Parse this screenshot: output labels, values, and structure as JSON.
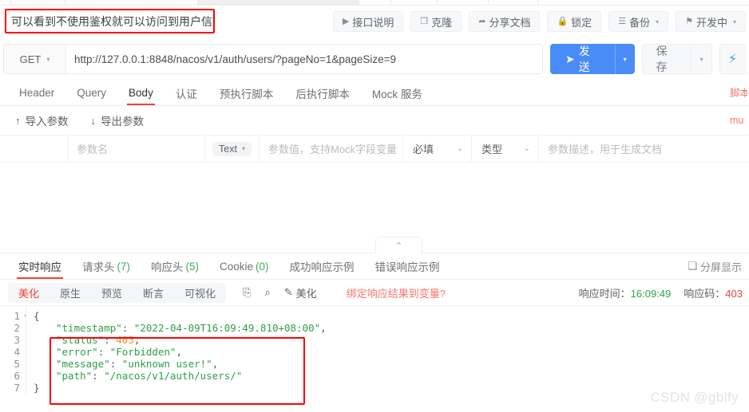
{
  "annotation": {
    "text": "可以看到不使用鉴权就可以访问到用户信息",
    "color": "#ff0000"
  },
  "toolbar": {
    "buttons": [
      {
        "icon": "play-icon",
        "glyph": "▶",
        "label": "接口说明",
        "caret": ""
      },
      {
        "icon": "clone-icon",
        "glyph": "❐",
        "label": "克隆",
        "caret": ""
      },
      {
        "icon": "share-icon",
        "glyph": "➦",
        "label": "分享文档",
        "caret": ""
      },
      {
        "icon": "lock-icon",
        "glyph": "🔒",
        "label": "锁定",
        "caret": ""
      },
      {
        "icon": "backup-icon",
        "glyph": "☰",
        "label": "备份",
        "caret": "▾"
      },
      {
        "icon": "flag-icon",
        "glyph": "⚑",
        "label": "开发中",
        "caret": "▾"
      }
    ]
  },
  "request": {
    "method": "GET",
    "method_caret": "▾",
    "url": "http://127.0.0.1:8848/nacos/v1/auth/users/?pageNo=1&pageSize=9",
    "send_label": "发送",
    "send_icon": "send-plane-icon",
    "send_glyph": "➤",
    "send_caret": "▾",
    "save_label": "保存",
    "save_caret": "▾",
    "bolt_icon": "lightning-icon",
    "bolt_glyph": "⚡",
    "accent": "#4a8cf7"
  },
  "request_tabs": {
    "items": [
      "Header",
      "Query",
      "Body",
      "认证",
      "预执行脚本",
      "后执行脚本",
      "Mock 服务"
    ],
    "active_index": 2,
    "edge_clipped_text": "脚本"
  },
  "params_actions": {
    "import_label": "导入参数",
    "import_icon": "arrow-up-icon",
    "import_glyph": "↑",
    "export_label": "导出参数",
    "export_icon": "arrow-down-icon",
    "export_glyph": "↓",
    "edge_clipped_text": "mu"
  },
  "params_row": {
    "name_placeholder": "参数名",
    "type_value": "Text",
    "type_caret": "▾",
    "value_placeholder": "参数值，支持Mock字段变量",
    "required_label": "必填",
    "required_caret": "⌄",
    "kind_label": "类型",
    "kind_caret": "⌄",
    "desc_placeholder": "参数描述，用于生成文档"
  },
  "collapse": {
    "icon": "chevron-up-icon",
    "glyph": "⌃"
  },
  "response_tabs": {
    "items": [
      {
        "label": "实时响应",
        "count": ""
      },
      {
        "label": "请求头",
        "count": "(7)"
      },
      {
        "label": "响应头",
        "count": "(5)"
      },
      {
        "label": "Cookie",
        "count": "(0)"
      },
      {
        "label": "成功响应示例",
        "count": ""
      },
      {
        "label": "错误响应示例",
        "count": ""
      }
    ],
    "active_index": 0,
    "split_label": "分屏显示",
    "split_icon": "split-screen-icon",
    "split_glyph": "❏"
  },
  "format_bar": {
    "segments": [
      "美化",
      "原生",
      "预览",
      "断言",
      "可视化"
    ],
    "active_index": 0,
    "copy_icon": "copy-icon",
    "copy_glyph": "⎘",
    "search_icon": "search-icon",
    "search_glyph": "⌕",
    "beautify_icon": "brush-icon",
    "beautify_glyph": "✎",
    "beautify_label": "美化",
    "bind_label": "绑定响应结果到变量?",
    "time_label": "响应时间：",
    "time_value": "16:09:49",
    "code_label": "响应码：",
    "code_value": "403"
  },
  "response_body": {
    "lines": [
      "1",
      "2",
      "3",
      "4",
      "5",
      "6",
      "7"
    ],
    "open_brace": "{",
    "close_brace": "}",
    "entries": [
      {
        "key": "\"timestamp\"",
        "value": "\"2022-04-09T16:09:49.810+08:00\"",
        "type": "string",
        "comma": ","
      },
      {
        "key": "\"status\"",
        "value": "403",
        "type": "number",
        "comma": ","
      },
      {
        "key": "\"error\"",
        "value": "\"Forbidden\"",
        "type": "string",
        "comma": ","
      },
      {
        "key": "\"message\"",
        "value": "\"unknown user!\"",
        "type": "string",
        "comma": ","
      },
      {
        "key": "\"path\"",
        "value": "\"/nacos/v1/auth/users/\"",
        "type": "string",
        "comma": ""
      }
    ]
  },
  "watermark": {
    "text": "CSDN @gblfy"
  }
}
